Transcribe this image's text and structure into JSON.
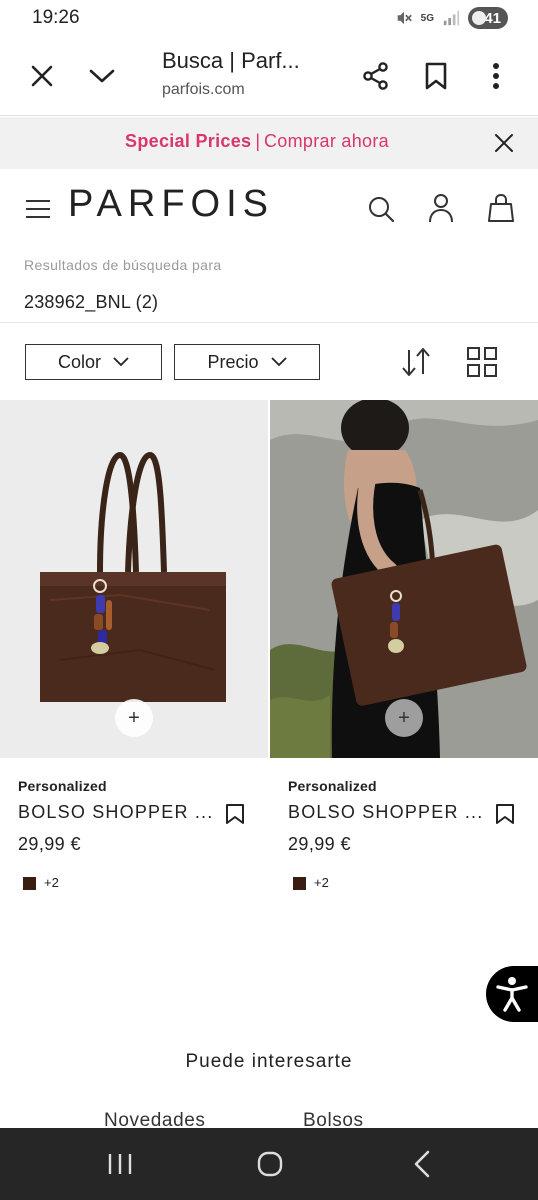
{
  "status_bar": {
    "time": "19:26",
    "network": "5G",
    "battery": "41",
    "icons": [
      "mute-icon",
      "signal-icon",
      "battery-icon"
    ]
  },
  "browser": {
    "title": "Busca | Parf...",
    "domain": "parfois.com",
    "icons": [
      "close-icon",
      "chevron-down-icon",
      "share-icon",
      "bookmark-icon",
      "more-vert-icon"
    ]
  },
  "promo": {
    "highlight": "Special Prices",
    "separator": "|",
    "cta": "Comprar ahora",
    "accent_color": "#d9356e"
  },
  "header": {
    "logo": "PARFOIS",
    "icons": [
      "menu-icon",
      "search-icon",
      "account-icon",
      "shopping-bag-icon"
    ]
  },
  "search": {
    "label": "Resultados de búsqueda para",
    "query": "238962_BNL (2)"
  },
  "filters": {
    "color_label": "Color",
    "price_label": "Precio",
    "icons": [
      "sort-icon",
      "grid-view-icon"
    ]
  },
  "products": [
    {
      "brand": "Personalized",
      "name": "BOLSO SHOPPER ...",
      "price": "29,99 €",
      "swatch_color": "#3b1c10",
      "more_colors": "+2",
      "quick_add": "+"
    },
    {
      "brand": "Personalized",
      "name": "BOLSO SHOPPER ...",
      "price": "29,99 €",
      "swatch_color": "#3b1c10",
      "more_colors": "+2",
      "quick_add": "+"
    }
  ],
  "recommendations": {
    "title": "Puede interesarte",
    "tabs": [
      "Novedades",
      "Bolsos"
    ]
  },
  "system_nav": {
    "icons": [
      "recent-apps-icon",
      "home-icon",
      "back-icon"
    ]
  }
}
